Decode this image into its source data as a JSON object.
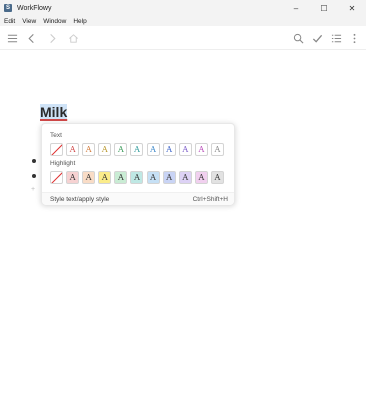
{
  "window": {
    "title": "WorkFlowy",
    "app_icon_letter": "S",
    "controls": [
      "–",
      "☐",
      "✕"
    ]
  },
  "menu": {
    "items": [
      "Edit",
      "View",
      "Window",
      "Help"
    ]
  },
  "toolbar": {
    "left_icons": [
      "menu-icon",
      "back-icon",
      "forward-icon",
      "home-icon"
    ],
    "right_icons": [
      "search-icon",
      "check-icon",
      "list-icon",
      "more-icon"
    ]
  },
  "document": {
    "title": "Milk",
    "add_bullet_symbol": "+"
  },
  "style_popup": {
    "text_section_label": "Text",
    "highlight_section_label": "Highlight",
    "swatch_letter": "A",
    "text_colors": [
      "#d04848",
      "#d27a3a",
      "#b8962a",
      "#3a9a5a",
      "#2e9a9a",
      "#3a86c8",
      "#3a62c8",
      "#7a5ac8",
      "#b84ab8",
      "#8a8a8a"
    ],
    "highlight_colors": [
      "#f6d2d2",
      "#f9dcc6",
      "#fbec8a",
      "#c9ecd4",
      "#bfe8e4",
      "#c6e0f5",
      "#c9d4f5",
      "#ddd2f5",
      "#f1d0ef",
      "#e2e2e2"
    ],
    "footer_label": "Style text/apply style",
    "footer_shortcut": "Ctrl+Shift+H"
  }
}
